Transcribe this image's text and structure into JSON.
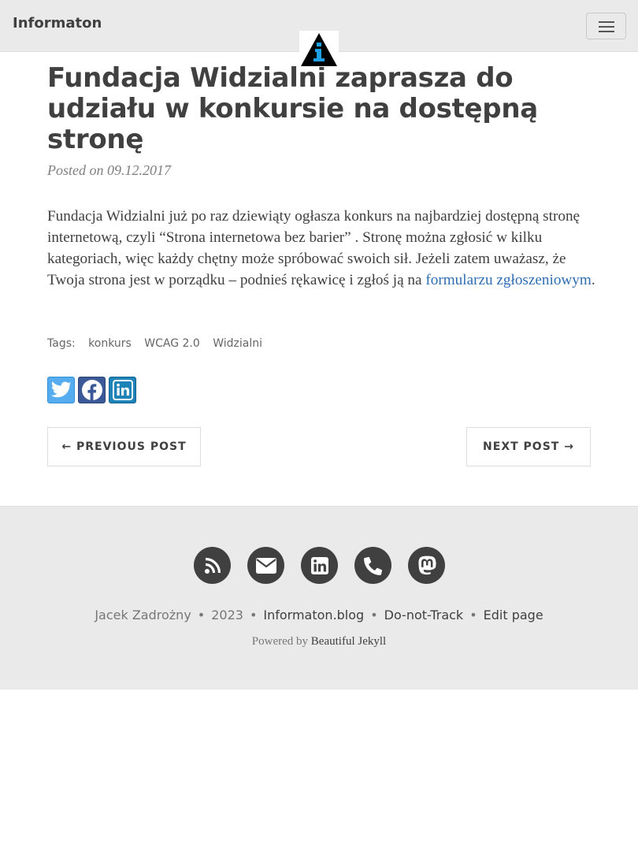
{
  "navbar": {
    "brand": "Informaton",
    "menu_icon": "hamburger-menu-icon",
    "avatar_icon": "info-triangle-logo"
  },
  "post": {
    "title": "Fundacja Widzialni zaprasza do udziału w konkursie na dostępną stronę",
    "meta_prefix": "Posted on",
    "date": "09.12.2017",
    "body_text": "Fundacja Widzialni już po raz dziewiąty ogłasza konkurs na najbardziej dostępną stronę internetową, czyli “Strona internetowa bez barier” . Stronę można zgłosić w kilku kategoriach, więc każdy chętny może spróbować swoich sił. Jeżeli zatem uważasz, że Twoja strona jest w porządku – podnieś rękawicę i zgłoś ją na ",
    "body_link": "formularzu zgłoszeniowym",
    "body_end": "."
  },
  "tags": {
    "label": "Tags:",
    "items": [
      "konkurs",
      "WCAG 2.0",
      "Widzialni"
    ]
  },
  "share": {
    "icons": [
      "twitter-icon",
      "facebook-icon",
      "linkedin-icon"
    ]
  },
  "pager": {
    "prev_label": "← PREVIOUS POST",
    "next_label": "NEXT POST →"
  },
  "footer": {
    "icons": [
      "rss-icon",
      "email-icon",
      "linkedin-icon",
      "phone-icon",
      "mastodon-icon"
    ],
    "author": "Jacek Zadrożny",
    "year": "2023",
    "site": "Informaton.blog",
    "dnt": "Do-not-Track",
    "edit": "Edit page",
    "separator": "•",
    "powered_prefix": "Powered by",
    "powered_link": "Beautiful Jekyll"
  },
  "colors": {
    "navbar_bg": "#eaeaea",
    "text": "#404040",
    "link": "#2f6db3",
    "twitter": "#55acee",
    "facebook": "#3b5998",
    "linkedin": "#1e84b8"
  }
}
